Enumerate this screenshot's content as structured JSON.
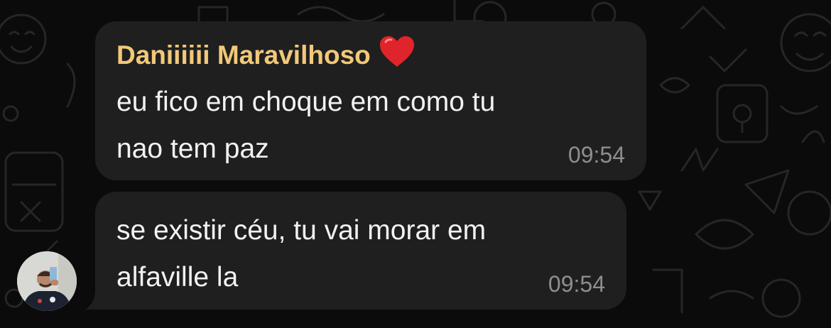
{
  "chat": {
    "messages": [
      {
        "sender": "Daniiiiii Maravilhoso",
        "sender_emoji": "heart-emoji",
        "text": "eu fico em choque em como tu\nnao tem paz",
        "time": "09:54"
      },
      {
        "text": "se existir céu, tu vai morar em\nalfaville la",
        "time": "09:54"
      }
    ]
  },
  "colors": {
    "background": "#0b0b0b",
    "bubble": "#1f1f1f",
    "sender_name": "#f2c879",
    "message_text": "#f2f2f2",
    "timestamp": "#8e8e8e",
    "heart": "#e0242b"
  }
}
